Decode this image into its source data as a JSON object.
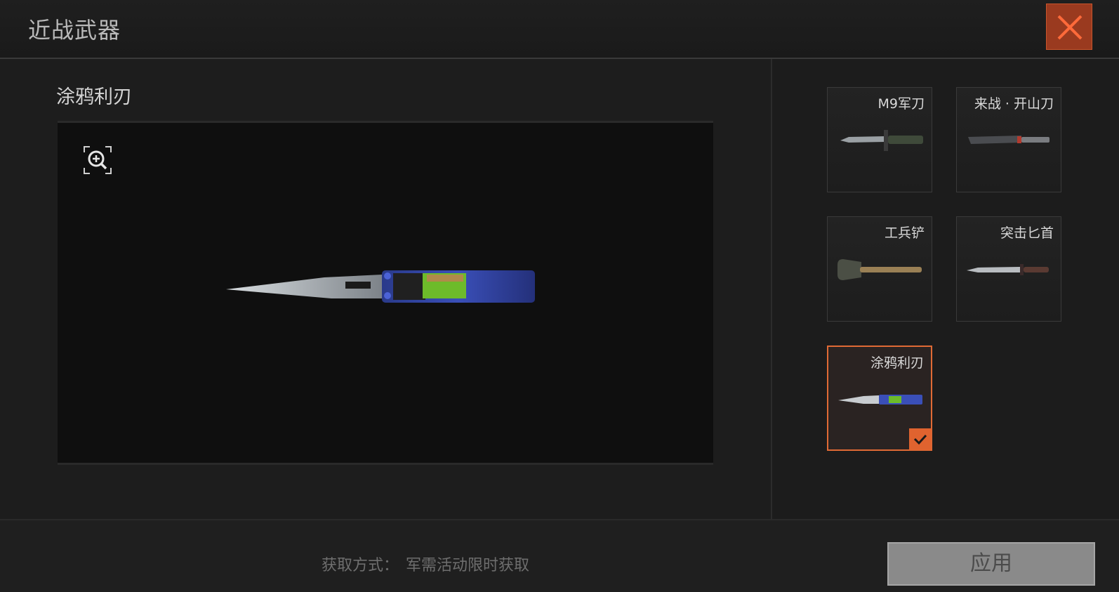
{
  "header": {
    "title": "近战武器",
    "close_icon": "close-x-icon",
    "accent": "#e0632f"
  },
  "preview": {
    "weapon_name": "涂鸦利刃",
    "zoom_icon": "zoom-in-icon"
  },
  "weapons": [
    {
      "label": "M9军刀",
      "selected": false
    },
    {
      "label": "来战 · 开山刀",
      "selected": false
    },
    {
      "label": "工兵铲",
      "selected": false
    },
    {
      "label": "突击匕首",
      "selected": false
    },
    {
      "label": "涂鸦利刃",
      "selected": true
    }
  ],
  "footer": {
    "source_label": "获取方式：",
    "source_value": "军需活动限时获取",
    "apply_label": "应用"
  }
}
